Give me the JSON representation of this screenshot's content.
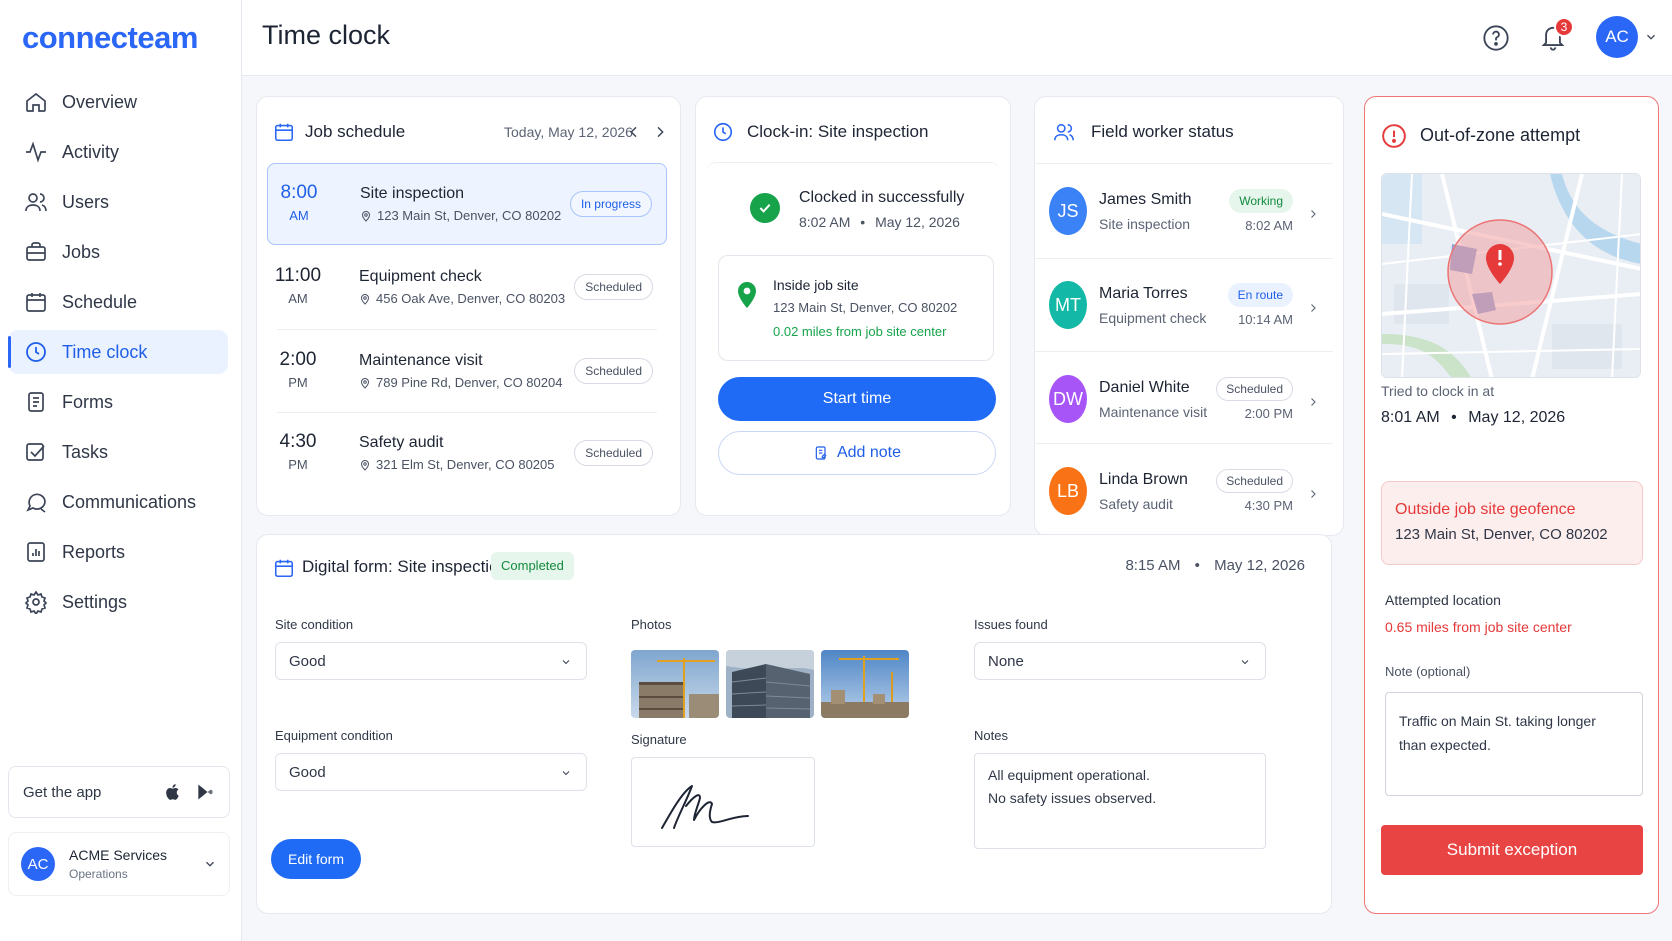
{
  "app": {
    "logo": "connecteam"
  },
  "sidebar": {
    "items": [
      {
        "label": "Overview",
        "icon": "home-icon"
      },
      {
        "label": "Activity",
        "icon": "activity-icon"
      },
      {
        "label": "Users",
        "icon": "users-icon"
      },
      {
        "label": "Jobs",
        "icon": "briefcase-icon"
      },
      {
        "label": "Schedule",
        "icon": "calendar-icon"
      },
      {
        "label": "Time clock",
        "icon": "clock-icon",
        "active": true
      },
      {
        "label": "Forms",
        "icon": "document-icon"
      },
      {
        "label": "Tasks",
        "icon": "checkbox-icon"
      },
      {
        "label": "Communications",
        "icon": "chat-icon"
      },
      {
        "label": "Reports",
        "icon": "report-icon"
      },
      {
        "label": "Settings",
        "icon": "gear-icon"
      }
    ],
    "get_app": "Get the app",
    "account": {
      "initials": "AC",
      "name": "ACME Services",
      "role": "Operations"
    }
  },
  "header": {
    "title": "Time clock",
    "notifications": "3",
    "user_initials": "AC"
  },
  "schedule": {
    "title": "Job schedule",
    "date": "Today, May 12, 2026",
    "jobs": [
      {
        "time": "8:00",
        "ampm": "AM",
        "name": "Site inspection",
        "address": "123 Main St, Denver, CO 80202",
        "status": "In progress"
      },
      {
        "time": "11:00",
        "ampm": "AM",
        "name": "Equipment check",
        "address": "456 Oak Ave, Denver, CO 80203",
        "status": "Scheduled"
      },
      {
        "time": "2:00",
        "ampm": "PM",
        "name": "Maintenance visit",
        "address": "789 Pine Rd, Denver, CO 80204",
        "status": "Scheduled"
      },
      {
        "time": "4:30",
        "ampm": "PM",
        "name": "Safety audit",
        "address": "321 Elm St, Denver, CO 80205",
        "status": "Scheduled"
      }
    ]
  },
  "clockin": {
    "title": "Clock-in: Site inspection",
    "success": "Clocked in successfully",
    "success_time": "8:02 AM",
    "success_date": "May 12, 2026",
    "location_title": "Inside job site",
    "location_address": "123 Main St, Denver, CO 80202",
    "distance": "0.02 miles from job site center",
    "start_label": "Start time",
    "note_label": "Add note"
  },
  "workers": {
    "title": "Field worker status",
    "list": [
      {
        "initials": "JS",
        "name": "James Smith",
        "job": "Site inspection",
        "status": "Working",
        "time": "8:02 AM",
        "color": "#3b82f6",
        "pill_bg": "#e6f6ec",
        "pill_fg": "#138a3e",
        "pill_border": "#e6f6ec"
      },
      {
        "initials": "MT",
        "name": "Maria Torres",
        "job": "Equipment check",
        "status": "En route",
        "time": "10:14 AM",
        "color": "#14b8a6",
        "pill_bg": "#eaf1ff",
        "pill_fg": "#1f5fe8",
        "pill_border": "#eaf1ff"
      },
      {
        "initials": "DW",
        "name": "Daniel White",
        "job": "Maintenance visit",
        "status": "Scheduled",
        "time": "2:00 PM",
        "color": "#a855f7",
        "pill_bg": "#ffffff",
        "pill_fg": "#4a5263",
        "pill_border": "#d7dbe3"
      },
      {
        "initials": "LB",
        "name": "Linda Brown",
        "job": "Safety audit",
        "status": "Scheduled",
        "time": "4:30 PM",
        "color": "#f97316",
        "pill_bg": "#ffffff",
        "pill_fg": "#4a5263",
        "pill_border": "#d7dbe3"
      }
    ]
  },
  "form": {
    "title": "Digital form: Site inspection",
    "status": "Completed",
    "time": "8:15 AM",
    "date": "May 12, 2026",
    "site_condition_label": "Site condition",
    "site_condition_value": "Good",
    "equipment_condition_label": "Equipment condition",
    "equipment_condition_value": "Good",
    "photos_label": "Photos",
    "signature_label": "Signature",
    "issues_label": "Issues found",
    "issues_value": "None",
    "notes_label": "Notes",
    "notes_line1": "All equipment operational.",
    "notes_line2": "No safety issues observed.",
    "edit_label": "Edit form"
  },
  "out_of_zone": {
    "title": "Out-of-zone attempt",
    "tried_label": "Tried to clock in at",
    "tried_time": "8:01 AM",
    "tried_date": "May 12, 2026",
    "alert_title": "Outside job site geofence",
    "alert_address": "123 Main St, Denver, CO 80202",
    "attempted_label": "Attempted location",
    "attempted_distance": "0.65 miles from job site center",
    "note_label": "Note (optional)",
    "note_line1": "Traffic on Main St. taking longer",
    "note_line2": "than expected.",
    "submit_label": "Submit exception"
  },
  "colors": {
    "accent": "#2b67f6",
    "success": "#16a34a",
    "danger": "#e94444"
  }
}
